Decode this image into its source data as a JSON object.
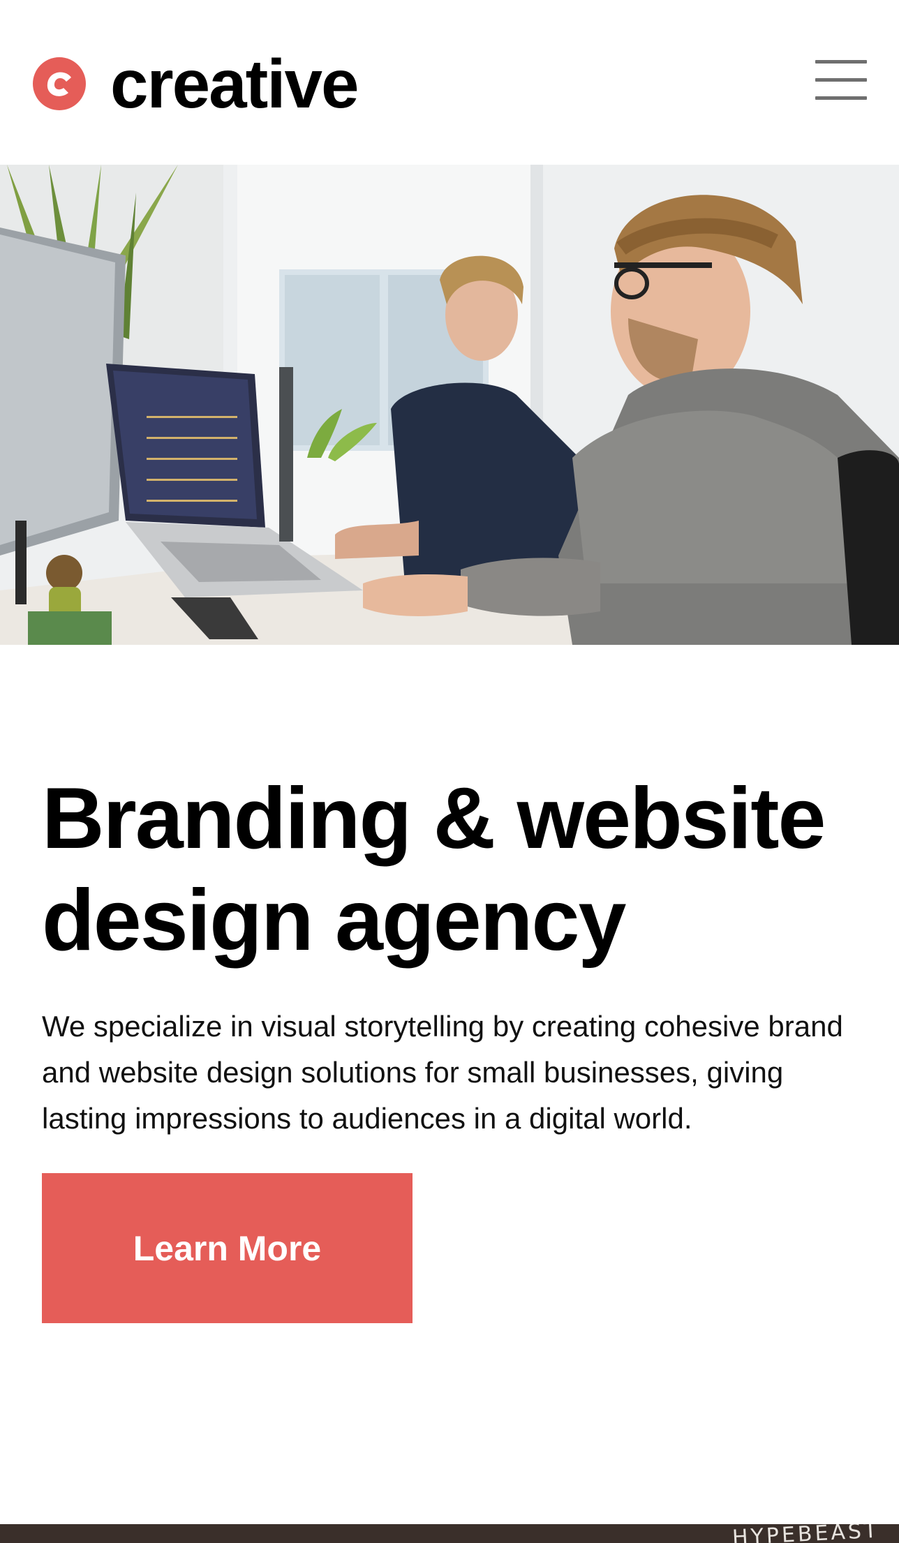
{
  "header": {
    "logo_text": "creative",
    "logo_icon": "c-logo-icon",
    "menu_icon": "hamburger-menu-icon"
  },
  "hero_image": {
    "description_icon": "office-photo"
  },
  "hero": {
    "title_line1": "Branding & website",
    "title_line2": "design agency",
    "text": "We specialize in visual storytelling by creating cohesive brand and website design solutions for small businesses, giving lasting impressions to audiences in a digital world.",
    "cta_label": "Learn More"
  },
  "bottom_image": {
    "visible_text": "HYPEBEAST"
  },
  "colors": {
    "accent": "#e55d58",
    "menu": "#6f6f6f",
    "text": "#000000"
  }
}
